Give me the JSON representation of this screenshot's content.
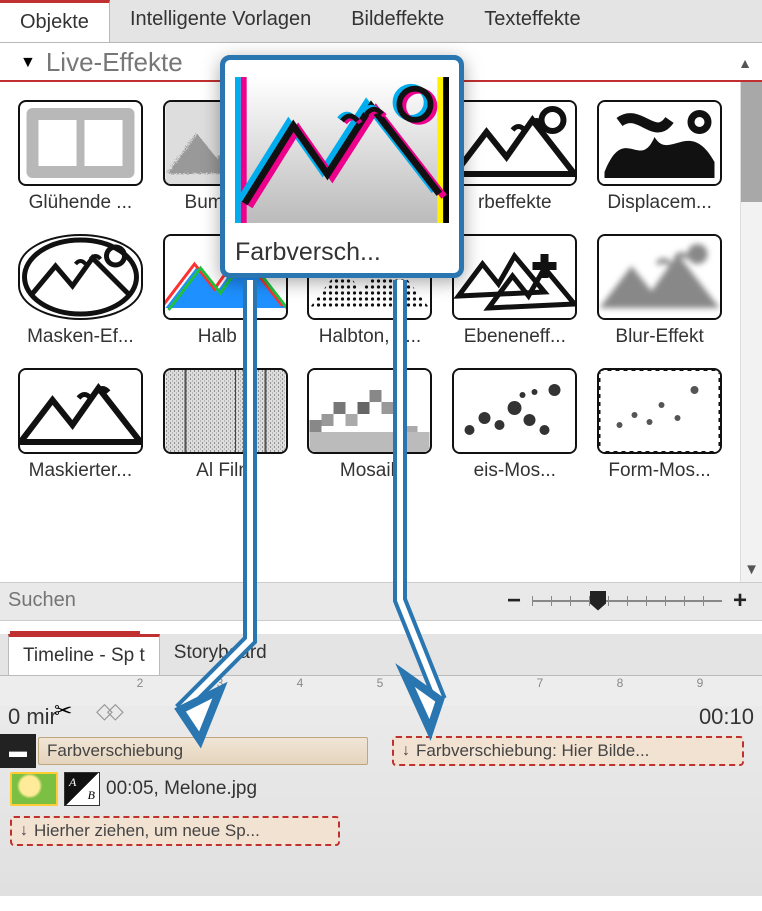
{
  "tabs": {
    "items": [
      "Objekte",
      "Intelligente Vorlagen",
      "Bildeffekte",
      "Texteffekte"
    ],
    "active": 0
  },
  "effects_section": {
    "title": "Live-Effekte",
    "highlighted": {
      "label": "Farbversch..."
    },
    "row1": [
      {
        "label": "Glühende ..."
      },
      {
        "label": "Bumpm..."
      },
      {
        "label": ""
      },
      {
        "label": "rbeffekte"
      },
      {
        "label": "Displacem..."
      }
    ],
    "row2": [
      {
        "label": "Masken-Ef..."
      },
      {
        "label": "Halb       n"
      },
      {
        "label": "Halbton, e..."
      },
      {
        "label": "Ebeneneff..."
      },
      {
        "label": "Blur-Effekt"
      }
    ],
    "row3": [
      {
        "label": "Maskierter..."
      },
      {
        "label": "Al       Film"
      },
      {
        "label": "Mosaik"
      },
      {
        "label": "eis-Mos..."
      },
      {
        "label": "Form-Mos..."
      }
    ]
  },
  "search": {
    "placeholder": "Suchen"
  },
  "lower_tabs": {
    "items": [
      "Timeline - Sp               t",
      "Storyboard"
    ],
    "active": 0
  },
  "timeline": {
    "left_time": "0 mir",
    "right_time": "00:10",
    "ruler_marks": [
      "2",
      "3",
      "4",
      "5",
      "7",
      "8",
      "9"
    ],
    "clip1": "Farbverschiebung",
    "media_label": "00:05, Melone.jpg",
    "drop1": "Hierher ziehen, um neue Sp...",
    "drop2": "Farbverschiebung: Hier Bilde..."
  }
}
